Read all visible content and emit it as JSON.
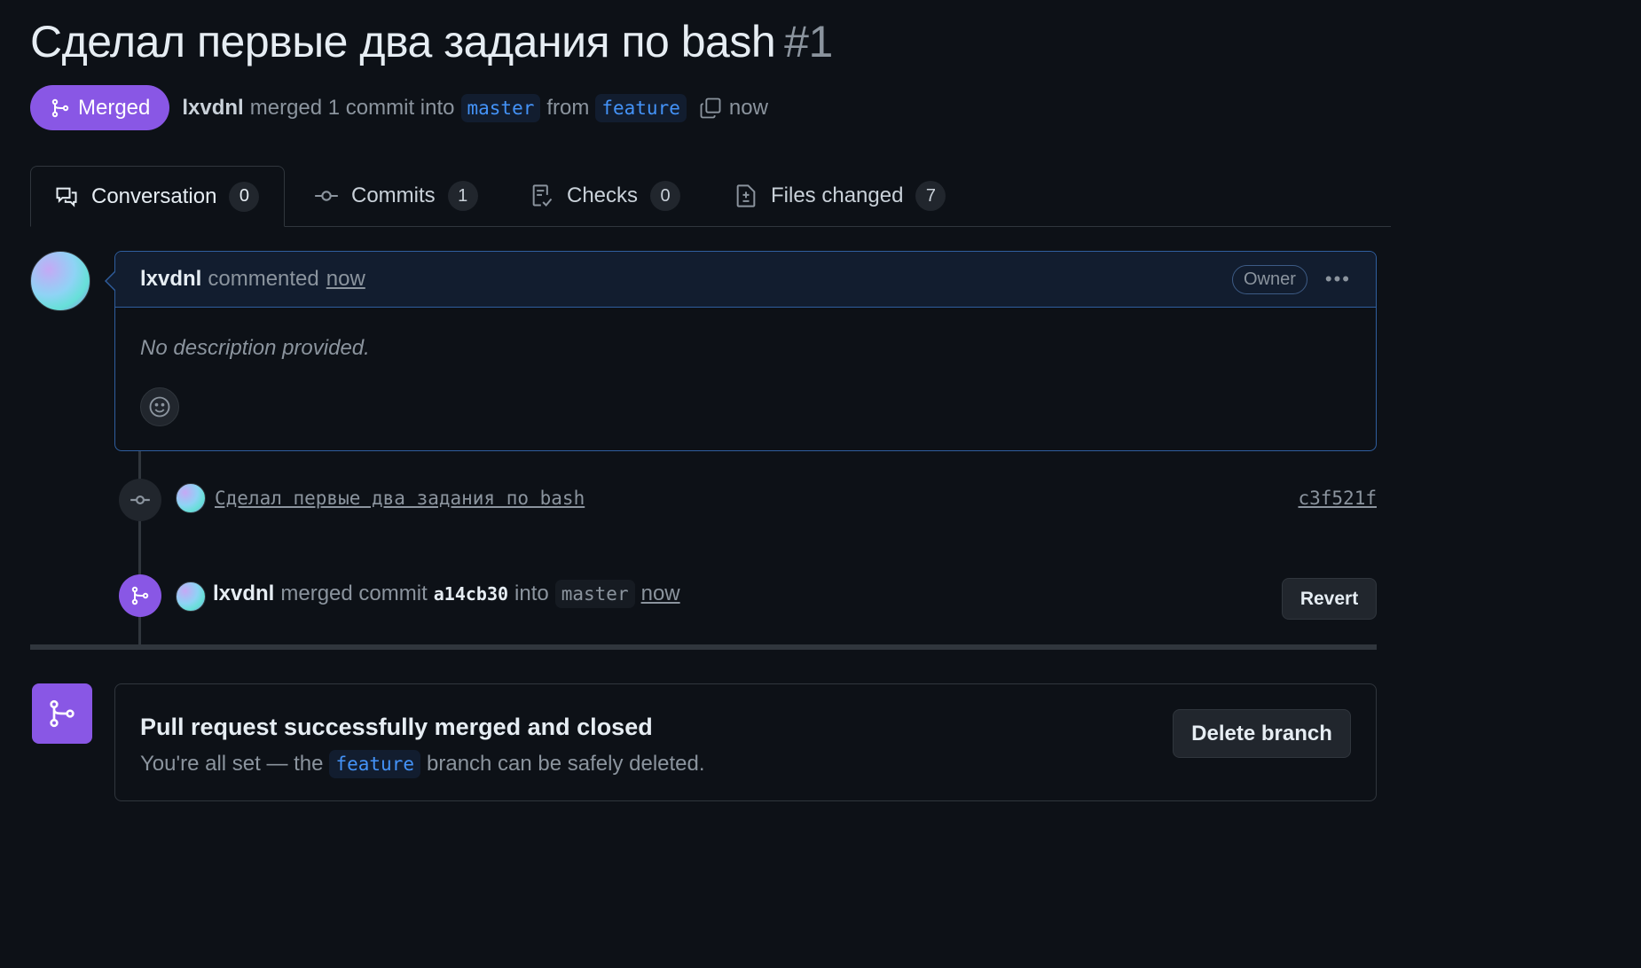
{
  "pr": {
    "title": "Сделал первые два задания по bash",
    "number": "#1",
    "state_label": "Merged",
    "author": "lxvdnl",
    "merge_text": "merged 1 commit into",
    "base_branch": "master",
    "from_text": "from",
    "head_branch": "feature",
    "time": "now"
  },
  "tabs": [
    {
      "label": "Conversation",
      "count": "0",
      "icon": "comment-discussion-icon"
    },
    {
      "label": "Commits",
      "count": "1",
      "icon": "git-commit-icon"
    },
    {
      "label": "Checks",
      "count": "0",
      "icon": "checklist-icon"
    },
    {
      "label": "Files changed",
      "count": "7",
      "icon": "file-diff-icon"
    }
  ],
  "comment": {
    "author": "lxvdnl",
    "action": "commented",
    "time": "now",
    "role": "Owner",
    "body": "No description provided."
  },
  "timeline": {
    "commit_message": "Сделал первые два задания по bash",
    "commit_sha": "c3f521f",
    "merge_author": "lxvdnl",
    "merge_text": "merged commit",
    "merge_sha": "a14cb30",
    "into_text": "into",
    "merge_branch": "master",
    "merge_time": "now",
    "revert_label": "Revert"
  },
  "merged_box": {
    "title": "Pull request successfully merged and closed",
    "desc_before": "You're all set — the",
    "branch": "feature",
    "desc_after": "branch can be safely deleted.",
    "delete_label": "Delete branch"
  },
  "colors": {
    "background": "#0d1117",
    "merged_purple": "#8957e5",
    "link_blue": "#4493f8",
    "border": "#30363d",
    "comment_border": "#2f5e9e"
  }
}
